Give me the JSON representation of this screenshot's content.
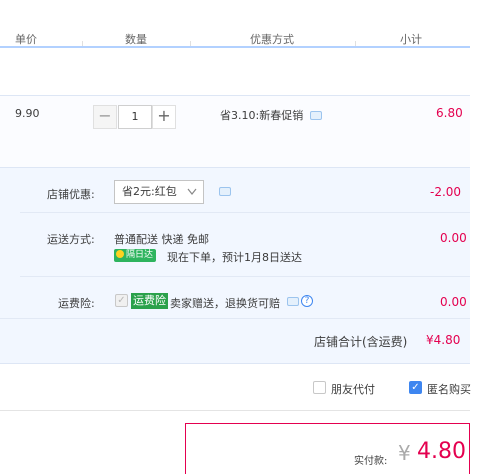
{
  "header": {
    "unit_price": "单价",
    "quantity": "数量",
    "discount_method": "优惠方式",
    "subtotal": "小计"
  },
  "item": {
    "price": "9.90",
    "qty_minus": "−",
    "qty_value": "1",
    "qty_plus": "+",
    "promo": "省3.10:新春促销",
    "subtotal": "6.80"
  },
  "shop": {
    "discount_label": "店铺优惠:",
    "discount_select": "省2元:红包",
    "discount_amount": "-2.00",
    "shipping_label": "运送方式:",
    "shipping_method": "普通配送 快递 免邮",
    "shipping_badge": "隔日达",
    "shipping_eta": "现在下单，预计1月8日送达",
    "shipping_amount": "0.00",
    "insurance_label": "运费险:",
    "insurance_tag": "运费险",
    "insurance_desc": "卖家赠送，退换货可赔",
    "insurance_amount": "0.00",
    "total_label": "店铺合计(含运费)",
    "total_amount": "¥4.80"
  },
  "options": {
    "friend_pay": "朋友代付",
    "anonymous": "匿名购买"
  },
  "pay": {
    "label": "实付款:",
    "currency": "¥",
    "amount": "4.80"
  },
  "colors": {
    "accent_red": "#e4004f",
    "accent_blue": "#3e86f0",
    "header_line": "#b2d1ff",
    "section_bg": "#f2f7ff",
    "green": "#2ba14b"
  }
}
